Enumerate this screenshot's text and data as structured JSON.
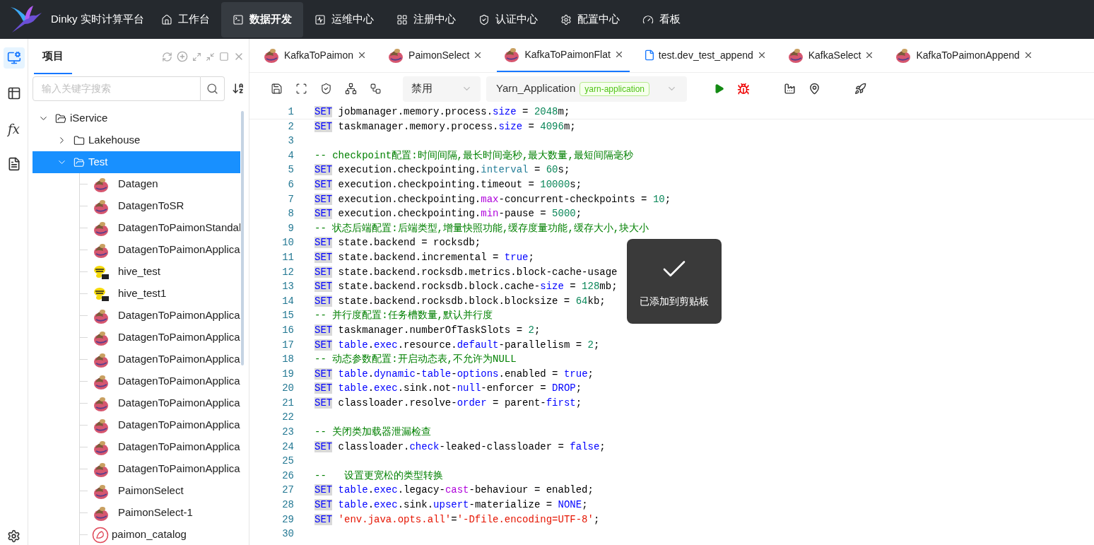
{
  "header": {
    "title": "Dinky 实时计算平台",
    "nav": [
      {
        "label": "工作台",
        "selected": false
      },
      {
        "label": "数据开发",
        "selected": true
      },
      {
        "label": "运维中心",
        "selected": false
      },
      {
        "label": "注册中心",
        "selected": false
      },
      {
        "label": "认证中心",
        "selected": false
      },
      {
        "label": "配置中心",
        "selected": false
      },
      {
        "label": "看板",
        "selected": false
      }
    ]
  },
  "rail": [
    {
      "kind": "sql",
      "selected": true
    },
    {
      "kind": "table",
      "selected": false
    },
    {
      "kind": "fx",
      "text": "fx",
      "selected": false
    },
    {
      "kind": "doc",
      "selected": false
    }
  ],
  "project_panel": {
    "tab": "项目",
    "search": {
      "placeholder": "输入关键字搜索"
    },
    "tree": [
      {
        "label": "iService",
        "kind": "folder",
        "expanded": true,
        "selected": false,
        "children": [
          {
            "label": "Lakehouse",
            "kind": "folder",
            "expanded": false,
            "selected": false
          },
          {
            "label": "Test",
            "kind": "folder",
            "expanded": true,
            "selected": true,
            "children": [
              {
                "label": "Datagen",
                "kind": "flink",
                "selected": false
              },
              {
                "label": "DatagenToSR",
                "kind": "flink",
                "selected": false
              },
              {
                "label": "DatagenToPaimonStandal",
                "kind": "flink",
                "selected": false
              },
              {
                "label": "DatagenToPaimonApplica",
                "kind": "flink",
                "selected": false
              },
              {
                "label": "hive_test",
                "kind": "hive",
                "selected": false
              },
              {
                "label": "hive_test1",
                "kind": "hive",
                "selected": false
              },
              {
                "label": "DatagenToPaimonApplica",
                "kind": "flink",
                "selected": false
              },
              {
                "label": "DatagenToPaimonApplica",
                "kind": "flink",
                "selected": false
              },
              {
                "label": "DatagenToPaimonApplica",
                "kind": "flink",
                "selected": false
              },
              {
                "label": "DatagenToPaimonApplica",
                "kind": "flink",
                "selected": false
              },
              {
                "label": "DatagenToPaimonApplica",
                "kind": "flink",
                "selected": false
              },
              {
                "label": "DatagenToPaimonApplica",
                "kind": "flink",
                "selected": false
              },
              {
                "label": "DatagenToPaimonApplica",
                "kind": "flink",
                "selected": false
              },
              {
                "label": "DatagenToPaimonApplica",
                "kind": "flink",
                "selected": false
              },
              {
                "label": "PaimonSelect",
                "kind": "flink",
                "selected": false
              },
              {
                "label": "PaimonSelect-1",
                "kind": "flink",
                "selected": false
              },
              {
                "label": "paimon_catalog",
                "kind": "catalog",
                "selected": false
              }
            ]
          }
        ]
      }
    ]
  },
  "editor_tabs": [
    {
      "label": "KafkaToPaimon",
      "kind": "flink",
      "selected": false
    },
    {
      "label": "PaimonSelect",
      "kind": "flink",
      "selected": false
    },
    {
      "label": "KafkaToPaimonFlat",
      "kind": "flink",
      "selected": true
    },
    {
      "label": "test.dev_test_append",
      "kind": "file",
      "selected": false
    },
    {
      "label": "KafkaSelect",
      "kind": "flink",
      "selected": false
    },
    {
      "label": "KafkaToPaimonAppend",
      "kind": "flink",
      "selected": false
    }
  ],
  "toolbar": {
    "alert_select": "禁用",
    "mode_select": "Yarn_Application",
    "mode_tag": "yarn-application"
  },
  "code": [
    {
      "no": "1",
      "tokens": [
        {
          "text": "SET",
          "kind": "kw"
        },
        {
          "text": " jobmanager.memory.process.",
          "kind": "id"
        },
        {
          "text": "size",
          "kind": "fn"
        },
        {
          "text": " = ",
          "kind": "id"
        },
        {
          "text": "2048",
          "kind": "num"
        },
        {
          "text": "m;",
          "kind": "id"
        }
      ]
    },
    {
      "no": "2",
      "tokens": [
        {
          "text": "SET",
          "kind": "kw"
        },
        {
          "text": " taskmanager.memory.process.",
          "kind": "id"
        },
        {
          "text": "size",
          "kind": "fn"
        },
        {
          "text": " = ",
          "kind": "id"
        },
        {
          "text": "4096",
          "kind": "num"
        },
        {
          "text": "m;",
          "kind": "id"
        }
      ]
    },
    {
      "no": "3"
    },
    {
      "no": "4",
      "tokens": [
        {
          "text": "-- checkpoint配置:时间间隔,最长时间毫秒,最大数量,最短间隔毫秒",
          "kind": "cm"
        }
      ]
    },
    {
      "no": "5",
      "tokens": [
        {
          "text": "SET",
          "kind": "kw"
        },
        {
          "text": " execution.checkpointing.",
          "kind": "id"
        },
        {
          "text": "interval",
          "kind": "ty"
        },
        {
          "text": " = ",
          "kind": "id"
        },
        {
          "text": "60",
          "kind": "num"
        },
        {
          "text": "s;",
          "kind": "id"
        }
      ]
    },
    {
      "no": "6",
      "tokens": [
        {
          "text": "SET",
          "kind": "kw"
        },
        {
          "text": " execution.checkpointing.timeout = ",
          "kind": "id"
        },
        {
          "text": "10000",
          "kind": "num"
        },
        {
          "text": "s;",
          "kind": "id"
        }
      ]
    },
    {
      "no": "7",
      "tokens": [
        {
          "text": "SET",
          "kind": "kw"
        },
        {
          "text": " execution.checkpointing.",
          "kind": "id"
        },
        {
          "text": "max",
          "kind": "pu"
        },
        {
          "text": "-concurrent-checkpoints = ",
          "kind": "id"
        },
        {
          "text": "10",
          "kind": "num"
        },
        {
          "text": ";",
          "kind": "id"
        }
      ]
    },
    {
      "no": "8",
      "tokens": [
        {
          "text": "SET",
          "kind": "kw"
        },
        {
          "text": " execution.checkpointing.",
          "kind": "id"
        },
        {
          "text": "min",
          "kind": "pu"
        },
        {
          "text": "-pause = ",
          "kind": "id"
        },
        {
          "text": "5000",
          "kind": "num"
        },
        {
          "text": ";",
          "kind": "id"
        }
      ]
    },
    {
      "no": "9",
      "tokens": [
        {
          "text": "-- 状态后端配置:后端类型,增量快照功能,缓存度量功能,缓存大小,块大小",
          "kind": "cm"
        }
      ]
    },
    {
      "no": "10",
      "tokens": [
        {
          "text": "SET",
          "kind": "kw"
        },
        {
          "text": " state.backend = rocksdb;",
          "kind": "id"
        }
      ]
    },
    {
      "no": "11",
      "tokens": [
        {
          "text": "SET",
          "kind": "kw"
        },
        {
          "text": " state.backend.incremental = ",
          "kind": "id"
        },
        {
          "text": "true",
          "kind": "fn"
        },
        {
          "text": ";",
          "kind": "id"
        }
      ]
    },
    {
      "no": "12",
      "tokens": [
        {
          "text": "SET",
          "kind": "kw"
        },
        {
          "text": " state.backend.rocksdb.metrics.block-cache-usage",
          "kind": "id"
        }
      ]
    },
    {
      "no": "13",
      "tokens": [
        {
          "text": "SET",
          "kind": "kw"
        },
        {
          "text": " state.backend.rocksdb.block.cache-",
          "kind": "id"
        },
        {
          "text": "size",
          "kind": "fn"
        },
        {
          "text": " = ",
          "kind": "id"
        },
        {
          "text": "128",
          "kind": "num"
        },
        {
          "text": "mb;",
          "kind": "id"
        }
      ]
    },
    {
      "no": "14",
      "tokens": [
        {
          "text": "SET",
          "kind": "kw"
        },
        {
          "text": " state.backend.rocksdb.block.blocksize = ",
          "kind": "id"
        },
        {
          "text": "64",
          "kind": "num"
        },
        {
          "text": "kb;",
          "kind": "id"
        }
      ]
    },
    {
      "no": "15",
      "tokens": [
        {
          "text": "-- 并行度配置:任务槽数量,默认并行度",
          "kind": "cm"
        }
      ]
    },
    {
      "no": "16",
      "tokens": [
        {
          "text": "SET",
          "kind": "kw"
        },
        {
          "text": " taskmanager.numberOfTaskSlots = ",
          "kind": "id"
        },
        {
          "text": "2",
          "kind": "num"
        },
        {
          "text": ";",
          "kind": "id"
        }
      ]
    },
    {
      "no": "17",
      "tokens": [
        {
          "text": "SET",
          "kind": "kw"
        },
        {
          "text": " table",
          "kind": "fn"
        },
        {
          "text": ".",
          "kind": "id"
        },
        {
          "text": "exec",
          "kind": "fn"
        },
        {
          "text": ".resource.",
          "kind": "id"
        },
        {
          "text": "default",
          "kind": "fn"
        },
        {
          "text": "-parallelism = ",
          "kind": "id"
        },
        {
          "text": "2",
          "kind": "num"
        },
        {
          "text": ";",
          "kind": "id"
        }
      ]
    },
    {
      "no": "18",
      "tokens": [
        {
          "text": "-- 动态参数配置:开启动态表,不允许为NULL",
          "kind": "cm"
        }
      ]
    },
    {
      "no": "19",
      "tokens": [
        {
          "text": "SET",
          "kind": "kw"
        },
        {
          "text": " table",
          "kind": "fn"
        },
        {
          "text": ".",
          "kind": "id"
        },
        {
          "text": "dynamic",
          "kind": "fn"
        },
        {
          "text": "-",
          "kind": "id"
        },
        {
          "text": "table",
          "kind": "fn"
        },
        {
          "text": "-",
          "kind": "id"
        },
        {
          "text": "options",
          "kind": "fn"
        },
        {
          "text": ".enabled = ",
          "kind": "id"
        },
        {
          "text": "true",
          "kind": "fn"
        },
        {
          "text": ";",
          "kind": "id"
        }
      ]
    },
    {
      "no": "20",
      "tokens": [
        {
          "text": "SET",
          "kind": "kw"
        },
        {
          "text": " table",
          "kind": "fn"
        },
        {
          "text": ".",
          "kind": "id"
        },
        {
          "text": "exec",
          "kind": "fn"
        },
        {
          "text": ".sink.not-",
          "kind": "id"
        },
        {
          "text": "null",
          "kind": "fn"
        },
        {
          "text": "-enforcer = ",
          "kind": "id"
        },
        {
          "text": "DROP",
          "kind": "fn"
        },
        {
          "text": ";",
          "kind": "id"
        }
      ]
    },
    {
      "no": "21",
      "tokens": [
        {
          "text": "SET",
          "kind": "kw"
        },
        {
          "text": " classloader.resolve-",
          "kind": "id"
        },
        {
          "text": "order",
          "kind": "fn"
        },
        {
          "text": " = parent-",
          "kind": "id"
        },
        {
          "text": "first",
          "kind": "fn"
        },
        {
          "text": ";",
          "kind": "id"
        }
      ]
    },
    {
      "no": "22"
    },
    {
      "no": "23",
      "tokens": [
        {
          "text": "-- 关闭类加载器泄漏检查",
          "kind": "cm"
        }
      ]
    },
    {
      "no": "24",
      "tokens": [
        {
          "text": "SET",
          "kind": "kw"
        },
        {
          "text": " classloader.",
          "kind": "id"
        },
        {
          "text": "check",
          "kind": "fn"
        },
        {
          "text": "-leaked-classloader = ",
          "kind": "id"
        },
        {
          "text": "false",
          "kind": "fn"
        },
        {
          "text": ";",
          "kind": "id"
        }
      ]
    },
    {
      "no": "25"
    },
    {
      "no": "26",
      "tokens": [
        {
          "text": "--   设置更宽松的类型转换",
          "kind": "cm"
        }
      ]
    },
    {
      "no": "27",
      "tokens": [
        {
          "text": "SET",
          "kind": "kw"
        },
        {
          "text": " table",
          "kind": "fn"
        },
        {
          "text": ".",
          "kind": "id"
        },
        {
          "text": "exec",
          "kind": "fn"
        },
        {
          "text": ".legacy-",
          "kind": "id"
        },
        {
          "text": "cast",
          "kind": "pu"
        },
        {
          "text": "-behaviour = enabled;",
          "kind": "id"
        }
      ]
    },
    {
      "no": "28",
      "tokens": [
        {
          "text": "SET",
          "kind": "kw"
        },
        {
          "text": " table",
          "kind": "fn"
        },
        {
          "text": ".",
          "kind": "id"
        },
        {
          "text": "exec",
          "kind": "fn"
        },
        {
          "text": ".sink.",
          "kind": "id"
        },
        {
          "text": "upsert",
          "kind": "fn"
        },
        {
          "text": "-materialize = ",
          "kind": "id"
        },
        {
          "text": "NONE",
          "kind": "fn"
        },
        {
          "text": ";",
          "kind": "id"
        }
      ]
    },
    {
      "no": "29",
      "tokens": [
        {
          "text": "SET",
          "kind": "kw"
        },
        {
          "text": " 'env.java.opts.all'",
          "kind": "str"
        },
        {
          "text": "=",
          "kind": "id"
        },
        {
          "text": "'-Dfile.encoding=UTF-8'",
          "kind": "str"
        },
        {
          "text": ";",
          "kind": "id"
        }
      ]
    },
    {
      "no": "30"
    }
  ],
  "toast": {
    "message": "已添加到剪贴板"
  }
}
